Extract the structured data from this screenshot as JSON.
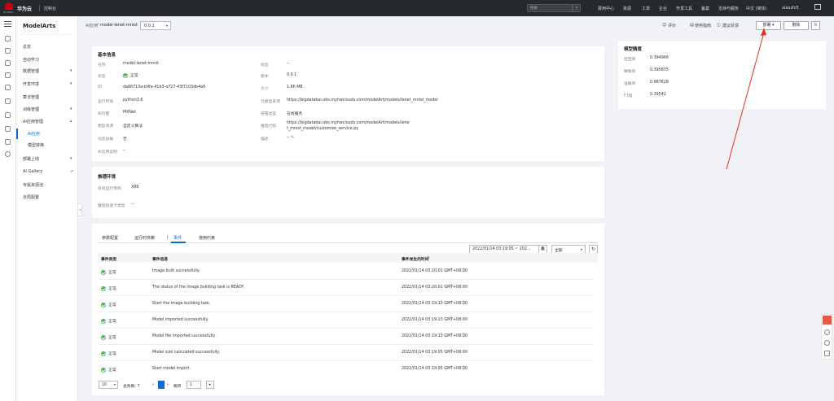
{
  "topbar": {
    "logo_text": "HUAWEI",
    "brand": "华为云",
    "console": "控制台",
    "search_placeholder": "搜索",
    "nav": [
      "费用中心",
      "资源",
      "工单",
      "企业",
      "开发工具",
      "备案",
      "支持与服务",
      "中文 (简体)",
      "xiaozhi5"
    ]
  },
  "sidebar_nav": {
    "title": "ModelArts",
    "items": [
      {
        "label": "总览"
      },
      {
        "label": "自动学习"
      },
      {
        "label": "数据管理"
      },
      {
        "label": "开发环境"
      },
      {
        "label": "算法管理"
      },
      {
        "label": "训练管理"
      },
      {
        "label": "AI应用管理"
      },
      {
        "label": "AI应用"
      },
      {
        "label": "模型转换"
      },
      {
        "label": "部署上线"
      },
      {
        "label": "AI Gallery"
      },
      {
        "label": "专属资源池"
      },
      {
        "label": "全局配置"
      }
    ]
  },
  "header": {
    "crumb_parent": "AI应用",
    "crumb_current": "model-lenet-mnist",
    "version": "0.0.1",
    "rate": "评价",
    "guide": "使用指南",
    "feedback": "建议反馈",
    "deploy": "部署",
    "delete": "删除"
  },
  "basic": {
    "title": "基本信息",
    "left": [
      {
        "label": "名称",
        "value": "model-lenet-mnist"
      },
      {
        "label": "状态",
        "value": "正常"
      },
      {
        "label": "ID",
        "value": "da66713a-b9fe-41b3-a727-43f7103db4a6"
      },
      {
        "label": "运行环境",
        "value": "python3.6"
      },
      {
        "label": "AI引擎",
        "value": "MXNet"
      },
      {
        "label": "模型来源",
        "value": "自定义算法"
      },
      {
        "label": "动态加载",
        "value": "否"
      },
      {
        "label": "AI应用说明",
        "value": "--"
      }
    ],
    "right": [
      {
        "label": "标签",
        "value": "--"
      },
      {
        "label": "版本",
        "value": "0.0.1"
      },
      {
        "label": "大小",
        "value": "1.66 MB"
      },
      {
        "label": "元模型来源",
        "value": "https://bigdatabai.obs.myhwclouds.com/modelArt/models/lenet_mnist_model"
      },
      {
        "label": "部署类型",
        "value": "在线服务"
      },
      {
        "label": "推理代码",
        "value": "https://bigdatabai.obs.myhwclouds.com/modelArt/models/lene"
      },
      {
        "label": "",
        "value": "t_mnist_model/customize_service.py"
      },
      {
        "label": "描述",
        "value": "--"
      }
    ]
  },
  "infer_env": {
    "title": "推理环境",
    "rows": [
      {
        "label": "系统运行架构",
        "value": "X86"
      },
      {
        "label": "推理加速卡类型",
        "value": "--"
      }
    ]
  },
  "tabs": [
    "参数配置",
    "运行时依赖",
    "事件",
    "使用约束"
  ],
  "active_tab": "事件",
  "filter": {
    "date_range": "2022/01/14 03:19:05  ~  202...",
    "select": "全部"
  },
  "events": {
    "headers": [
      "事件类型",
      "事件信息",
      "事件发生的时间"
    ],
    "rows": [
      {
        "type": "正常",
        "info": "Image built successfully.",
        "time": "2022/01/14 03:20:01 GMT+08:00"
      },
      {
        "type": "正常",
        "info": "The status of the image building task is READY.",
        "time": "2022/01/14 03:20:01 GMT+08:00"
      },
      {
        "type": "正常",
        "info": "Start the image building task.",
        "time": "2022/01/14 03:19:13 GMT+08:00"
      },
      {
        "type": "正常",
        "info": "Model imported successfully.",
        "time": "2022/01/14 03:19:13 GMT+08:00"
      },
      {
        "type": "正常",
        "info": "Model file imported successfully.",
        "time": "2022/01/14 03:19:13 GMT+08:00"
      },
      {
        "type": "正常",
        "info": "Model size calculated successfully.",
        "time": "2022/01/14 03:19:05 GMT+08:00"
      },
      {
        "type": "正常",
        "info": "Start model import.",
        "time": "2022/01/14 03:19:05 GMT+08:00"
      }
    ]
  },
  "pagination": {
    "page_size": "10",
    "total": "总条数: 7",
    "goto_label": "跳转",
    "page": "1"
  },
  "model_metrics": {
    "title": "模型精度",
    "rows": [
      {
        "label": "召回率",
        "value": "0.394966"
      },
      {
        "label": "精确率",
        "value": "0.395875"
      },
      {
        "label": "准确率",
        "value": "0.987628"
      },
      {
        "label": "F1值",
        "value": "0.39542"
      }
    ]
  },
  "colors": {
    "accent": "#0a6cda",
    "topbar": "#252a2f",
    "status_ok": "#4caf50",
    "arrow": "#e0302a"
  }
}
